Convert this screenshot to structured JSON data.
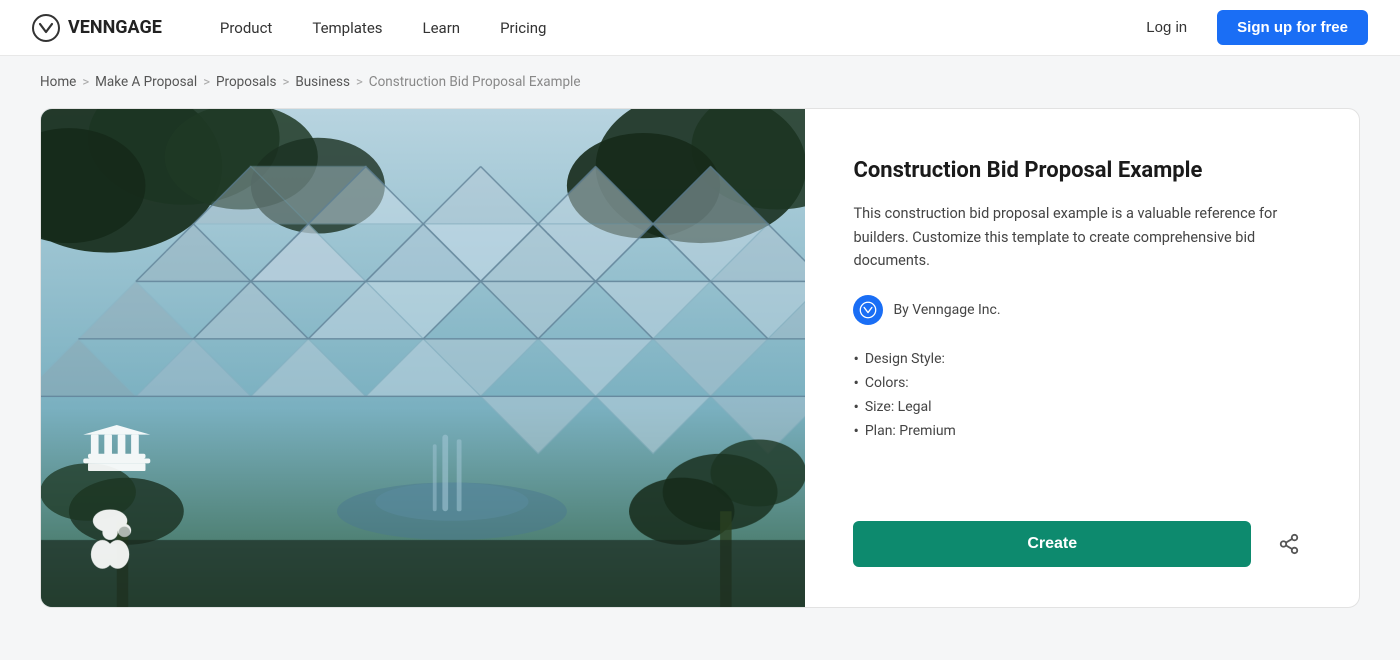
{
  "brand": {
    "name": "VENNGAGE",
    "logo_aria": "Venngage logo"
  },
  "nav": {
    "links": [
      {
        "label": "Product",
        "id": "product"
      },
      {
        "label": "Templates",
        "id": "templates"
      },
      {
        "label": "Learn",
        "id": "learn"
      },
      {
        "label": "Pricing",
        "id": "pricing"
      }
    ],
    "login_label": "Log in",
    "signup_label": "Sign up for free"
  },
  "breadcrumb": {
    "items": [
      {
        "label": "Home",
        "id": "home"
      },
      {
        "label": "Make A Proposal",
        "id": "make-a-proposal"
      },
      {
        "label": "Proposals",
        "id": "proposals"
      },
      {
        "label": "Business",
        "id": "business"
      },
      {
        "label": "Construction Bid Proposal Example",
        "id": "current",
        "current": true
      }
    ]
  },
  "template": {
    "title": "Construction Bid Proposal Example",
    "description": "This construction bid proposal example is a valuable reference for builders. Customize this template to create comprehensive bid documents.",
    "author": "By Venngage Inc.",
    "meta": [
      {
        "label": "Design Style:"
      },
      {
        "label": "Colors:"
      },
      {
        "label": "Size: Legal"
      },
      {
        "label": "Plan: Premium"
      }
    ],
    "create_label": "Create",
    "share_label": "Share"
  }
}
